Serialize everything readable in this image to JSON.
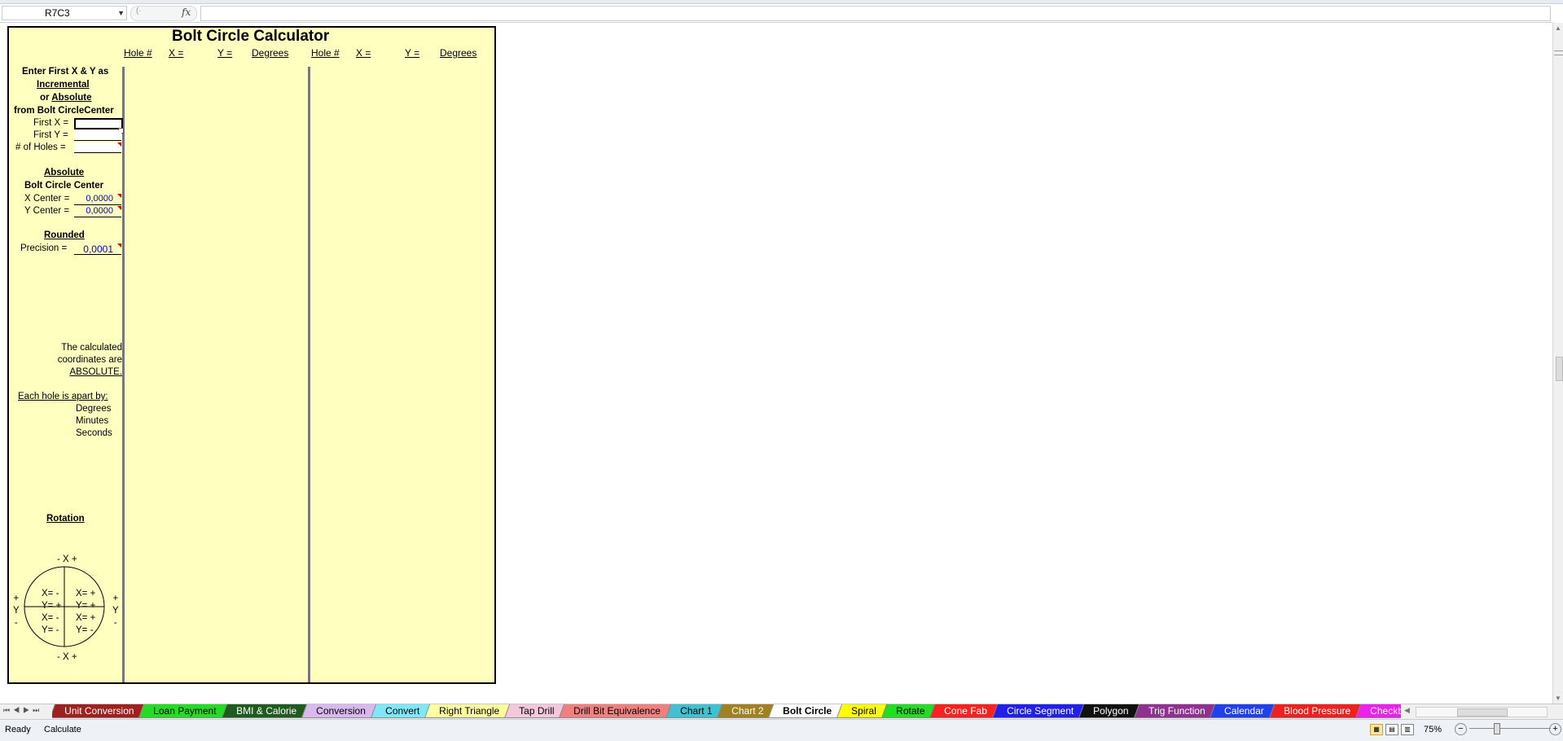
{
  "formula_bar": {
    "name_box": "R7C3",
    "name_box_dropdown_icon": "chevron-down-icon",
    "fx_label": "fx",
    "cancel_icon": "close-icon",
    "formula_value": ""
  },
  "sheet": {
    "title": "Bolt Circle Calculator",
    "headers": [
      "Hole #",
      "X =",
      "Y =",
      "Degrees",
      "Hole #",
      "X =",
      "Y =",
      "Degrees"
    ],
    "instructions": {
      "line1": "Enter First X & Y as",
      "line2": "Incremental",
      "line3_prefix": "or",
      "line3_word": "Absolute",
      "line4": "from Bolt CircleCenter"
    },
    "fields": {
      "first_x_label": "First X =",
      "first_x_value": "",
      "first_y_label": "First Y =",
      "first_y_value": "",
      "holes_label": "# of Holes =",
      "holes_value": ""
    },
    "center": {
      "heading": "Absolute",
      "subheading": "Bolt Circle Center",
      "x_label": "X Center =",
      "x_value": "0,0000",
      "y_label": "Y Center =",
      "y_value": "0,0000"
    },
    "rounding": {
      "heading": "Rounded",
      "precision_label": "Precision =",
      "precision_value": "0,0001"
    },
    "note": {
      "line1": "The calculated",
      "line2": "coordinates are",
      "line3": "ABSOLUTE."
    },
    "apart": {
      "heading": "Each hole is apart by:",
      "degrees": "Degrees",
      "minutes": "Minutes",
      "seconds": "Seconds"
    },
    "rotation": {
      "heading": "Rotation",
      "top": "- X +",
      "bottom": "- X +",
      "left": [
        "+",
        "Y",
        "-"
      ],
      "right": [
        "+",
        "Y",
        "-"
      ],
      "q_tl": [
        "X= -",
        "Y= +"
      ],
      "q_tr": [
        "X= +",
        "Y= +"
      ],
      "q_bl": [
        "X= -",
        "Y= -"
      ],
      "q_br": [
        "X= +",
        "Y= -"
      ]
    }
  },
  "tabs": [
    {
      "label": "Unit Conversion",
      "color": "#a02020",
      "text_color": "#ffffff"
    },
    {
      "label": "Loan Payment",
      "color": "#22dd22",
      "text_color": "#000000"
    },
    {
      "label": "BMI & Calorie",
      "color": "#1f5a1f",
      "text_color": "#ffffff"
    },
    {
      "label": "Conversion",
      "color": "#d9b8f0",
      "text_color": "#000000"
    },
    {
      "label": "Convert",
      "color": "#7fe8f8",
      "text_color": "#000000"
    },
    {
      "label": "Right Triangle",
      "color": "#ffffa0",
      "text_color": "#000000"
    },
    {
      "label": "Tap Drill",
      "color": "#f4c8dc",
      "text_color": "#000000"
    },
    {
      "label": "Drill Bit Equivalence",
      "color": "#f08080",
      "text_color": "#000000"
    },
    {
      "label": "Chart 1",
      "color": "#40c0d0",
      "text_color": "#000000"
    },
    {
      "label": "Chart 2",
      "color": "#a08020",
      "text_color": "#ffffff"
    },
    {
      "label": "Bolt Circle",
      "color": "#ffffff",
      "text_color": "#000000",
      "active": true
    },
    {
      "label": "Spiral",
      "color": "#ffff00",
      "text_color": "#000000"
    },
    {
      "label": "Rotate",
      "color": "#22dd22",
      "text_color": "#000000"
    },
    {
      "label": "Cone Fab",
      "color": "#ff2020",
      "text_color": "#ffffff"
    },
    {
      "label": "Circle Segment",
      "color": "#2020ee",
      "text_color": "#ffffff"
    },
    {
      "label": "Polygon",
      "color": "#111111",
      "text_color": "#ffffff"
    },
    {
      "label": "Trig Function",
      "color": "#903090",
      "text_color": "#ffffff"
    },
    {
      "label": "Calendar",
      "color": "#2040f0",
      "text_color": "#ffffff"
    },
    {
      "label": "Blood Pressure",
      "color": "#ee2020",
      "text_color": "#ffffff"
    },
    {
      "label": "Checkbo",
      "color": "#ee20ee",
      "text_color": "#ffffff"
    }
  ],
  "status": {
    "ready": "Ready",
    "calculate": "Calculate",
    "zoom": "75%",
    "zoom_minus": "−",
    "zoom_plus": "+"
  }
}
